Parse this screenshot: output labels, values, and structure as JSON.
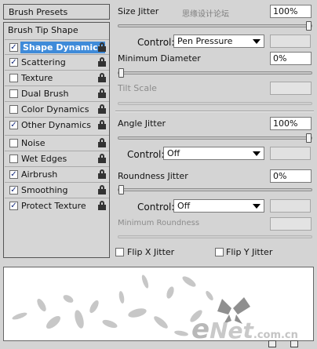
{
  "left": {
    "presets_label": "Brush Presets",
    "tip_shape_label": "Brush Tip Shape",
    "options": [
      {
        "label": "Shape Dynamics",
        "checked": true,
        "active": true
      },
      {
        "label": "Scattering",
        "checked": true,
        "active": false
      },
      {
        "label": "Texture",
        "checked": false,
        "active": false
      },
      {
        "label": "Dual Brush",
        "checked": false,
        "active": false
      },
      {
        "label": "Color Dynamics",
        "checked": false,
        "active": false
      },
      {
        "label": "Other Dynamics",
        "checked": true,
        "active": false
      },
      {
        "label": "Noise",
        "checked": false,
        "active": false
      },
      {
        "label": "Wet Edges",
        "checked": false,
        "active": false
      },
      {
        "label": "Airbrush",
        "checked": true,
        "active": false
      },
      {
        "label": "Smoothing",
        "checked": true,
        "active": false
      },
      {
        "label": "Protect Texture",
        "checked": true,
        "active": false
      }
    ],
    "check_mark": "✓"
  },
  "right": {
    "size_jitter": {
      "label": "Size Jitter",
      "value": "100%",
      "slider_pct": 100
    },
    "control1": {
      "label": "Control:",
      "value": "Pen Pressure"
    },
    "min_diameter": {
      "label": "Minimum Diameter",
      "value": "0%",
      "slider_pct": 0
    },
    "tilt_scale": {
      "label": "Tilt Scale"
    },
    "angle_jitter": {
      "label": "Angle Jitter",
      "value": "100%",
      "slider_pct": 100
    },
    "control2": {
      "label": "Control:",
      "value": "Off"
    },
    "roundness_jitter": {
      "label": "Roundness Jitter",
      "value": "0%",
      "slider_pct": 0
    },
    "control3": {
      "label": "Control:",
      "value": "Off"
    },
    "min_roundness": {
      "label": "Minimum Roundness"
    },
    "flip_x": {
      "label": "Flip X Jitter",
      "checked": false
    },
    "flip_y": {
      "label": "Flip Y Jitter",
      "checked": false
    }
  },
  "watermark": {
    "site_text": "思缘设计论坛",
    "logo_e": "e",
    "logo_rest": "Net",
    "logo_domain": ".com.cn"
  },
  "colors": {
    "selection": "#3f8bd9",
    "panel_bg": "#d4d4d4",
    "check": "#12287a"
  }
}
